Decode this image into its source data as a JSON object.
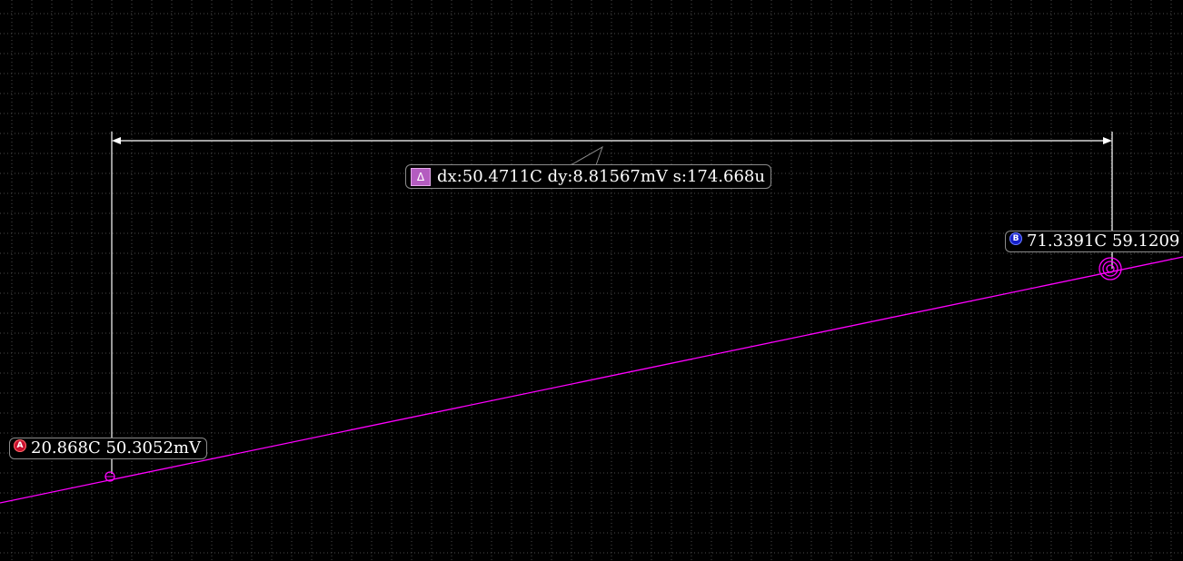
{
  "colors": {
    "background": "#000000",
    "grid": "#4a4a4a",
    "trace": "#ff00ff",
    "measure_line": "#ffffff",
    "marker_a": "#c8102e",
    "marker_b": "#1520c8",
    "delta_badge": "#b45cc0"
  },
  "chart_data": {
    "type": "line",
    "series": [
      {
        "x": [
          20.868,
          71.3391
        ],
        "y": [
          50.3052,
          59.1209
        ]
      }
    ],
    "grid": true
  },
  "cursor_a": {
    "badge": "A",
    "icon": "cursor-a-badge-icon",
    "readout": "20.868C 50.3052mV",
    "x": 20.868,
    "y": 50.3052
  },
  "cursor_b": {
    "badge": "B",
    "icon": "cursor-b-badge-icon",
    "readout": "71.3391C 59.1209",
    "x": 71.3391,
    "y": 59.1209
  },
  "delta": {
    "badge": "Δ",
    "icon": "delta-icon",
    "readout": "dx:50.4711C dy:8.81567mV s:174.668u"
  }
}
